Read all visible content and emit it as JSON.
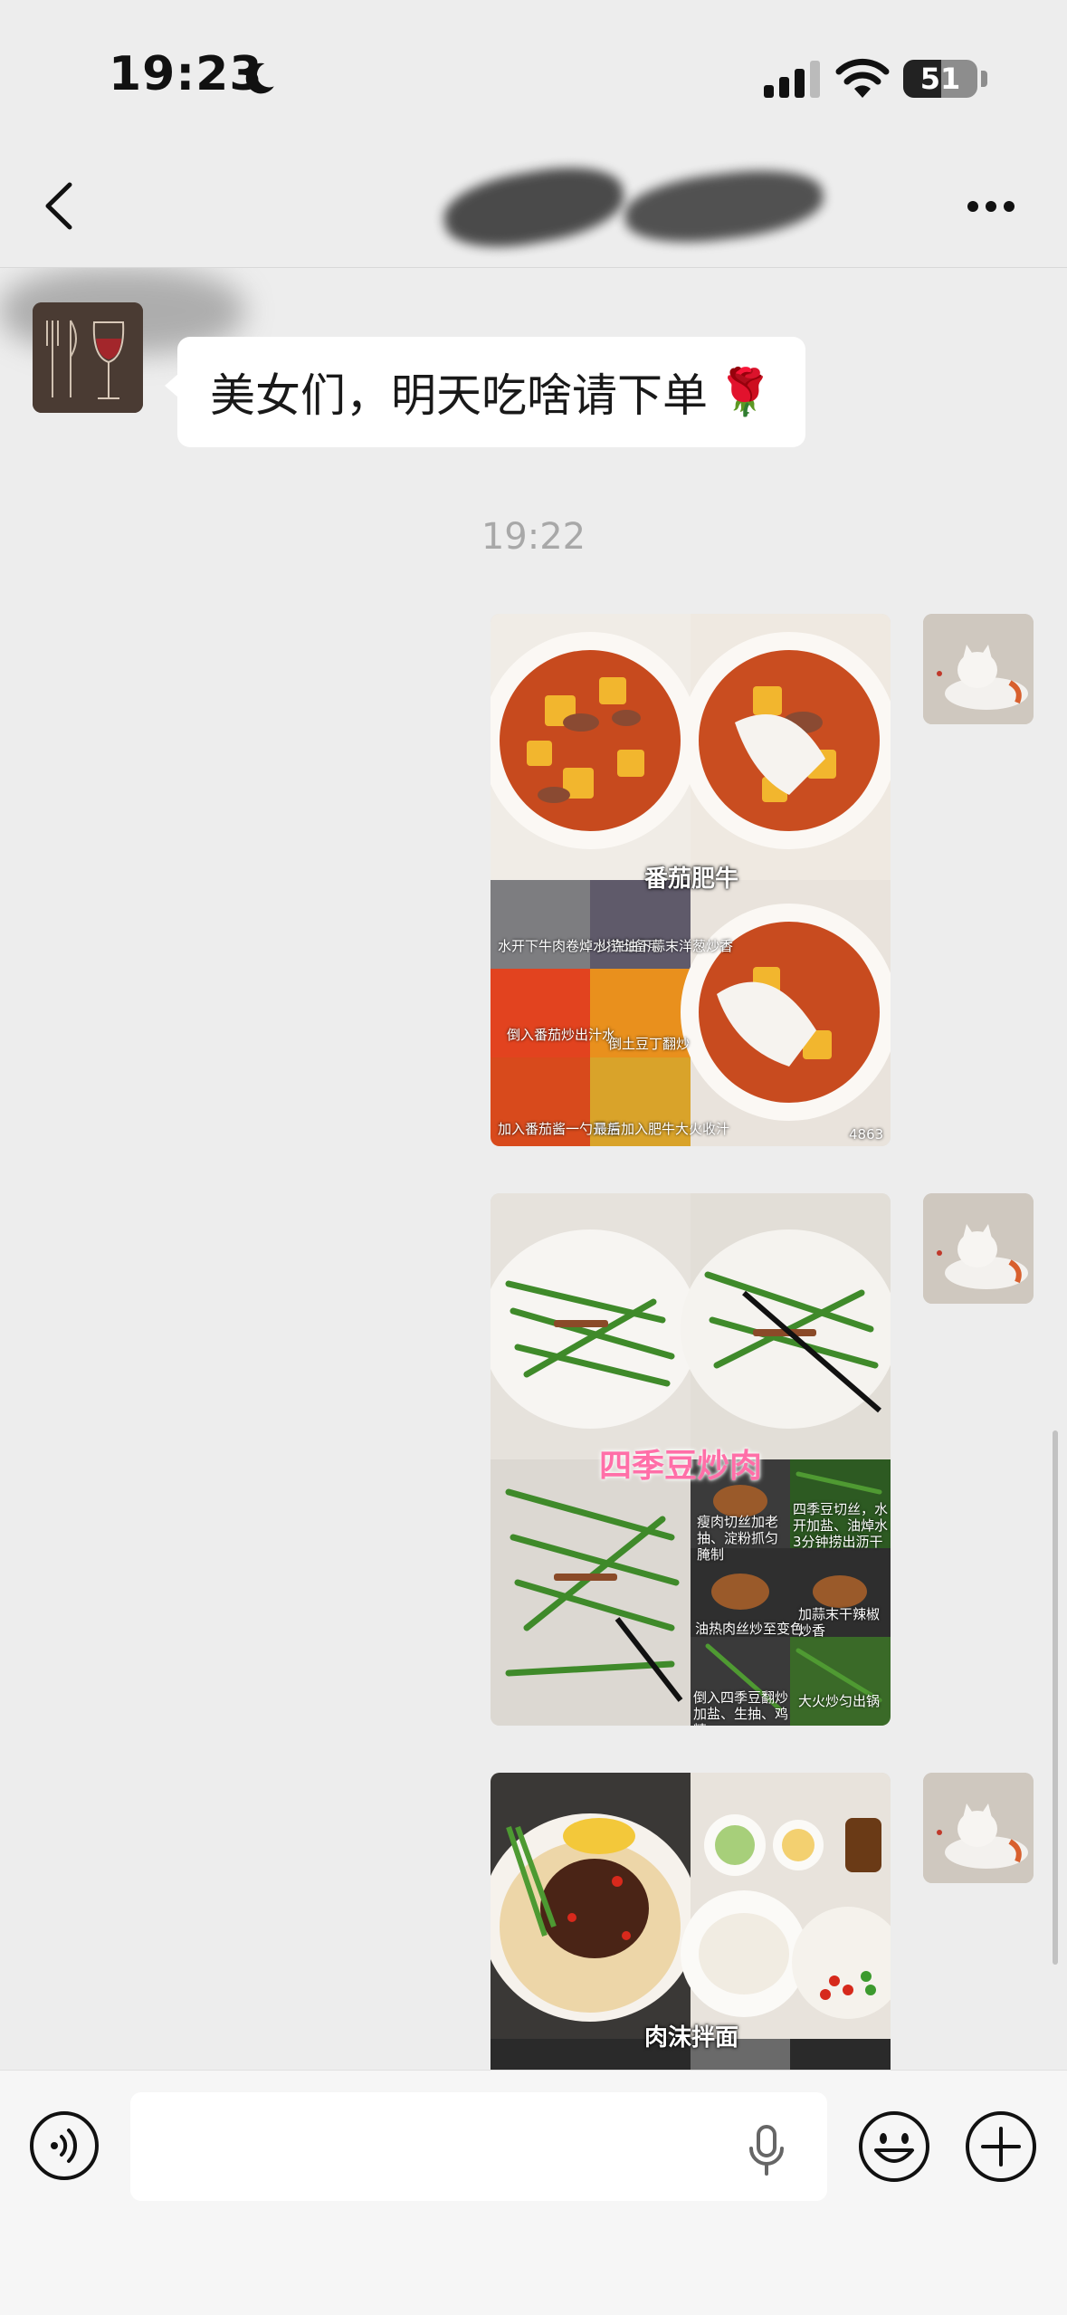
{
  "status_bar": {
    "time": "19:23",
    "battery": "51",
    "icons": [
      "moon-icon",
      "cellular-signal-icon",
      "wifi-icon",
      "battery-icon"
    ]
  },
  "nav": {
    "back_icon": "chevron-left-icon",
    "more_icon": "ellipsis-icon"
  },
  "messages": [
    {
      "type": "text",
      "side": "left",
      "text": "美女们，明天吃啥请下单",
      "emoji": "🌹"
    },
    {
      "type": "timestamp",
      "text": "19:22"
    },
    {
      "type": "image",
      "side": "right",
      "title": "番茄肥牛",
      "steps": [
        "水开下牛肉卷焯水捞出备用",
        "少许油下蒜末洋葱炒香",
        "倒入番茄炒出汁水",
        "倒土豆丁翻炒",
        "加入番茄酱一勺开盖",
        "最后加入肥牛大火收汁"
      ],
      "watermark": "4863"
    },
    {
      "type": "image",
      "side": "right",
      "title": "四季豆炒肉",
      "steps": [
        "瘦肉切丝加老抽、淀粉抓匀腌制",
        "四季豆切丝，水开加盐、油焯水3分钟捞出沥干",
        "油热肉丝炒至变色",
        "加蒜末干辣椒炒香",
        "倒入四季豆翻炒加盐、生抽、鸡精",
        "大火炒匀出锅"
      ]
    },
    {
      "type": "image",
      "side": "right",
      "title": "肉沫拌面"
    }
  ],
  "input": {
    "placeholder": "",
    "voice_icon": "voice-icon",
    "mic_icon": "microphone-icon",
    "emoji_icon": "smiley-icon",
    "plus_icon": "plus-circle-icon"
  }
}
